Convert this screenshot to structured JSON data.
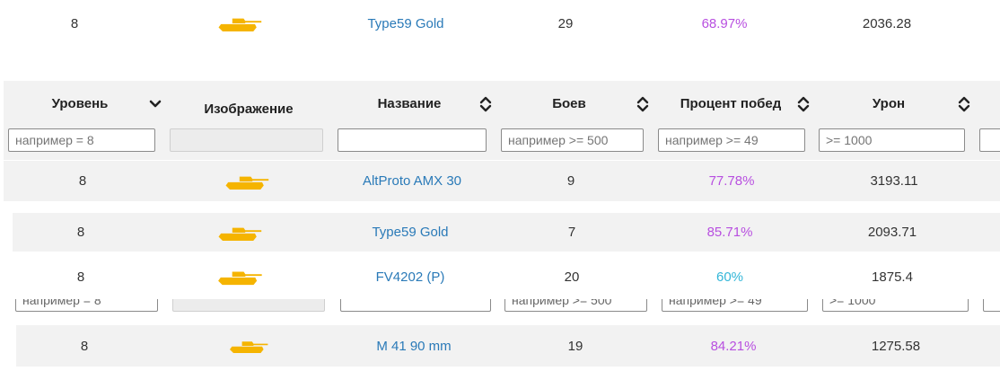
{
  "top_row": {
    "level": "8",
    "name": "Type59 Gold",
    "battles": "29",
    "winrate": "68.97%",
    "damage": "2036.28"
  },
  "header": {
    "columns": [
      {
        "label": "Уровень",
        "sort": "chevron-down"
      },
      {
        "label": "Изображение",
        "sort": "none"
      },
      {
        "label": "Название",
        "sort": "both"
      },
      {
        "label": "Боев",
        "sort": "both"
      },
      {
        "label": "Процент побед",
        "sort": "both"
      },
      {
        "label": "Урон",
        "sort": "both"
      }
    ],
    "filters": [
      {
        "placeholder": "например = 8",
        "value": ""
      },
      {
        "placeholder": "",
        "value": "",
        "disabled": true
      },
      {
        "placeholder": "",
        "value": ""
      },
      {
        "placeholder": "например >= 500",
        "value": ""
      },
      {
        "placeholder": "например >= 49",
        "value": ""
      },
      {
        "placeholder": ">= 1000",
        "value": ""
      }
    ]
  },
  "rows": [
    {
      "level": "8",
      "name": "AltProto AMX 30",
      "battles": "9",
      "winrate": "77.78%",
      "damage": "3193.11",
      "winrate_color": "purple"
    },
    {
      "level": "8",
      "name": "Type59 Gold",
      "battles": "7",
      "winrate": "85.71%",
      "damage": "2093.71",
      "winrate_color": "purple"
    },
    {
      "level": "8",
      "name": "FV4202 (P)",
      "battles": "20",
      "winrate": "60%",
      "damage": "1875.4",
      "winrate_color": "cyan"
    },
    {
      "level": "8",
      "name": "M 41 90 mm",
      "battles": "19",
      "winrate": "84.21%",
      "damage": "1275.58",
      "winrate_color": "purple"
    }
  ],
  "ghost_filters": [
    "например = 8",
    "например >= 500",
    "например >= 49",
    ">= 1000"
  ],
  "colors": {
    "link": "#2a7ab8",
    "winrate_purple": "#b84fe0",
    "winrate_cyan": "#33b6d8",
    "tank": "#f5b400",
    "header_bg": "#f2f2f2"
  }
}
